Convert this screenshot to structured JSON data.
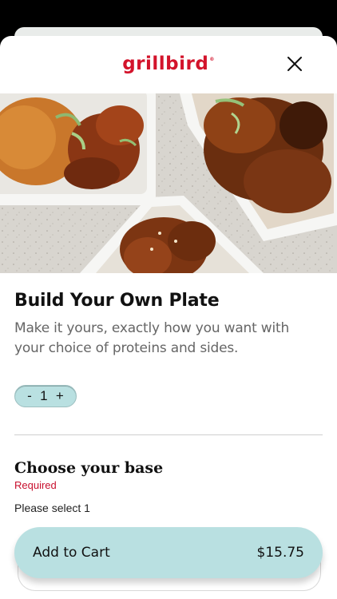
{
  "header": {
    "brand": "grillbird",
    "registered_mark": "®"
  },
  "product": {
    "title": "Build Your Own Plate",
    "description": "Make it yours, exactly how you want with your choice of proteins and sides."
  },
  "quantity": {
    "minus": "-",
    "value": "1",
    "plus": "+"
  },
  "section": {
    "title": "Choose your base",
    "required_label": "Required",
    "hint": "Please select 1"
  },
  "cart": {
    "label": "Add to Cart",
    "price": "$15.75"
  },
  "colors": {
    "brand_red": "#d3132b",
    "accent_teal": "#b9e0e1"
  }
}
